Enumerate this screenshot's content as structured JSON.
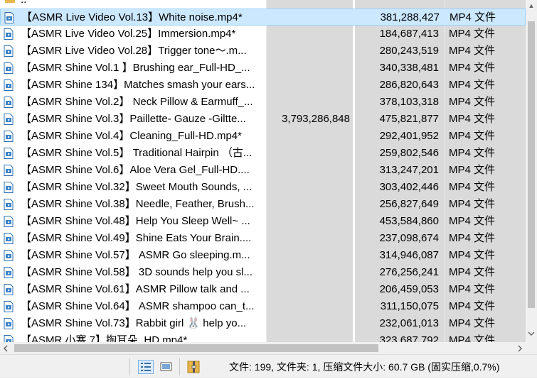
{
  "parent_row": {
    "name": ".."
  },
  "files": [
    {
      "name": "【ASMR Live Video Vol.13】White noise.mp4*",
      "packed": "",
      "size": "381,288,427",
      "type": "MP4 文件",
      "selected": true
    },
    {
      "name": "【ASMR Live Video Vol.25】Immersion.mp4*",
      "packed": "",
      "size": "184,687,413",
      "type": "MP4 文件"
    },
    {
      "name": "【ASMR Live Video Vol.28】Trigger tone～.m...",
      "packed": "",
      "size": "280,243,519",
      "type": "MP4 文件"
    },
    {
      "name": "【ASMR Shine  Vol.1 】Brushing ear_Full-HD_...",
      "packed": "",
      "size": "340,338,481",
      "type": "MP4 文件"
    },
    {
      "name": "【ASMR Shine 134】Matches smash your ears...",
      "packed": "",
      "size": "286,820,643",
      "type": "MP4 文件"
    },
    {
      "name": "【ASMR Shine Vol.2】 Neck Pillow & Earmuff_...",
      "packed": "",
      "size": "378,103,318",
      "type": "MP4 文件"
    },
    {
      "name": "【ASMR Shine Vol.3】Paillette-  Gauze  -Giltte...",
      "packed": "3,793,286,848",
      "size": "475,821,877",
      "type": "MP4 文件"
    },
    {
      "name": "【ASMR Shine Vol.4】Cleaning_Full-HD.mp4*",
      "packed": "",
      "size": "292,401,952",
      "type": "MP4 文件"
    },
    {
      "name": "【ASMR Shine Vol.5】 Traditional Hairpin （古...",
      "packed": "",
      "size": "259,802,546",
      "type": "MP4 文件"
    },
    {
      "name": "【ASMR Shine Vol.6】Aloe Vera Gel_Full-HD....",
      "packed": "",
      "size": "313,247,201",
      "type": "MP4 文件"
    },
    {
      "name": "【ASMR Shine Vol.32】Sweet Mouth Sounds, ...",
      "packed": "",
      "size": "303,402,446",
      "type": "MP4 文件"
    },
    {
      "name": "【ASMR Shine Vol.38】Needle, Feather, Brush...",
      "packed": "",
      "size": "256,827,649",
      "type": "MP4 文件"
    },
    {
      "name": "【ASMR Shine Vol.48】Help You Sleep Well~ ...",
      "packed": "",
      "size": "453,584,860",
      "type": "MP4 文件"
    },
    {
      "name": "【ASMR Shine Vol.49】Shine Eats Your Brain....",
      "packed": "",
      "size": "237,098,674",
      "type": "MP4 文件"
    },
    {
      "name": "【ASMR Shine Vol.57】 ASMR Go sleeping.m...",
      "packed": "",
      "size": "314,946,087",
      "type": "MP4 文件"
    },
    {
      "name": "【ASMR Shine Vol.58】 3D sounds help you sl...",
      "packed": "",
      "size": "276,256,241",
      "type": "MP4 文件"
    },
    {
      "name": "【ASMR Shine Vol.61】ASMR Pillow talk and ...",
      "packed": "",
      "size": "206,459,053",
      "type": "MP4 文件"
    },
    {
      "name": "【ASMR Shine Vol.64】 ASMR shampoo can_t...",
      "packed": "",
      "size": "311,150,075",
      "type": "MP4 文件"
    },
    {
      "name": "【ASMR Shine Vol.73】Rabbit girl 🐰 help yo...",
      "packed": "",
      "size": "232,061,013",
      "type": "MP4 文件"
    },
    {
      "name": "【ASMR 小寒 7】掏耳朵_HD.mp4*",
      "packed": "",
      "size": "323,687,792",
      "type": "MP4 文件"
    }
  ],
  "status_bar": {
    "summary": "文件: 199, 文件夹: 1, 压缩文件大小: 60.7 GB (固实压缩,0.7%)"
  },
  "colors": {
    "selection": "#cce8ff",
    "column_shade": "#dadada",
    "folder": "#e8b64a"
  },
  "icons": {
    "file": "video-file-icon",
    "folder": "folder-icon",
    "details_view": "details-view-icon",
    "preview_view": "preview-view-icon",
    "archive": "archive-icon"
  }
}
